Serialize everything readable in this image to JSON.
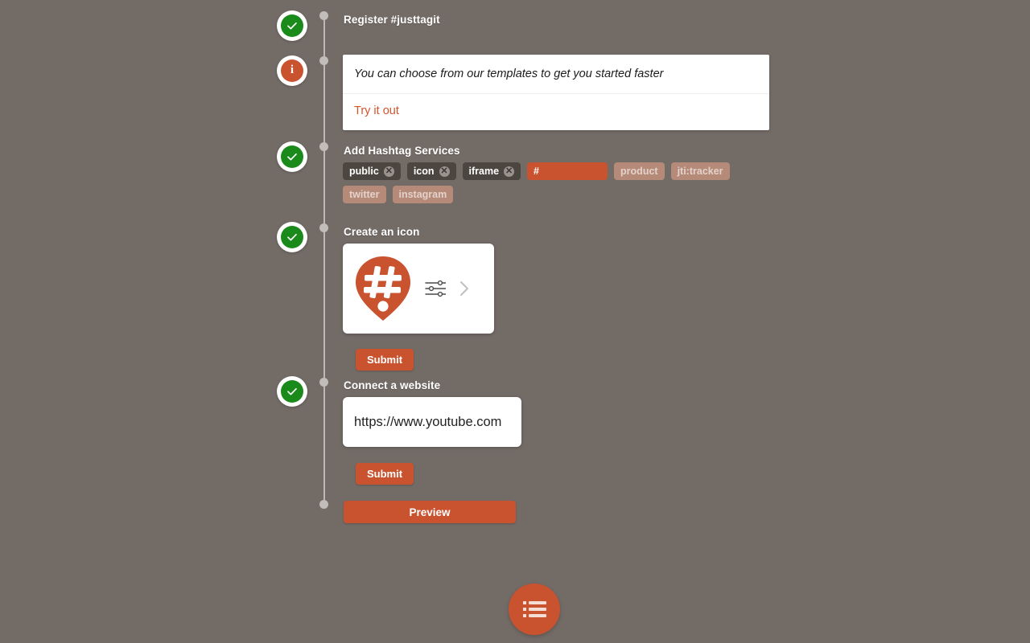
{
  "theme": {
    "background": "#736b66",
    "accent": "#c9522f",
    "success": "#1a8a1a",
    "tag_selected_bg": "#4c4641",
    "tag_suggest_bg": "#b68a78",
    "timeline": "#bdb8b4"
  },
  "steps": [
    {
      "id": "register",
      "marker": "check-icon",
      "title": "Register #justtagit"
    },
    {
      "id": "templates",
      "marker": "info-icon",
      "message": "You can choose from our templates to get you started faster",
      "cta": "Try it out"
    },
    {
      "id": "hashtag-services",
      "marker": "check-icon",
      "title": "Add Hashtag Services",
      "selected_tags": [
        {
          "label": "public",
          "remove": "✕"
        },
        {
          "label": "icon",
          "remove": "✕"
        },
        {
          "label": "iframe",
          "remove": "✕"
        }
      ],
      "input_value": "#",
      "input_placeholder": "#",
      "suggestions": [
        {
          "label": "product"
        },
        {
          "label": "jti:tracker"
        },
        {
          "label": "twitter"
        },
        {
          "label": "instagram"
        }
      ]
    },
    {
      "id": "create-icon",
      "marker": "check-icon",
      "title": "Create an icon",
      "icon_name": "hashtag-pin-icon",
      "settings_icon": "sliders-icon",
      "chevron_icon": "chevron-right-icon",
      "submit_label": "Submit"
    },
    {
      "id": "connect-website",
      "marker": "check-icon",
      "title": "Connect a website",
      "url_value": "https://www.youtube.com",
      "url_placeholder": "https://",
      "submit_label": "Submit"
    }
  ],
  "preview": {
    "label": "Preview"
  },
  "fab": {
    "icon": "list-menu-icon"
  }
}
